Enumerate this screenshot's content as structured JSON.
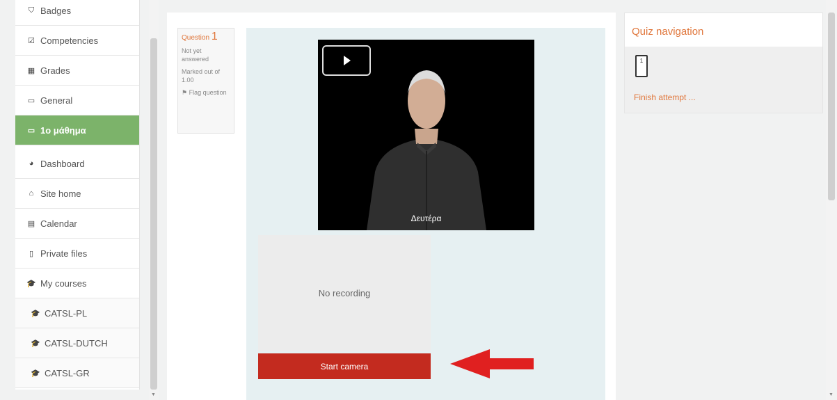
{
  "sidebar": {
    "items": [
      {
        "label": "Badges",
        "icon": "shield-icon",
        "glyph": "⛉"
      },
      {
        "label": "Competencies",
        "icon": "checkbox-icon",
        "glyph": "☑"
      },
      {
        "label": "Grades",
        "icon": "table-icon",
        "glyph": "▦"
      },
      {
        "label": "General",
        "icon": "folder-icon",
        "glyph": "▭"
      },
      {
        "label": "1ο μάθημα",
        "icon": "folder-icon",
        "glyph": "▭"
      },
      {
        "label": "Dashboard",
        "icon": "dashboard-icon",
        "glyph": "◕"
      },
      {
        "label": "Site home",
        "icon": "home-icon",
        "glyph": "⌂"
      },
      {
        "label": "Calendar",
        "icon": "calendar-icon",
        "glyph": "▤"
      },
      {
        "label": "Private files",
        "icon": "file-icon",
        "glyph": "▯"
      },
      {
        "label": "My courses",
        "icon": "graduation-cap-icon",
        "glyph": "🎓"
      },
      {
        "label": "CATSL-PL",
        "icon": "graduation-cap-icon",
        "glyph": "🎓"
      },
      {
        "label": "CATSL-DUTCH",
        "icon": "graduation-cap-icon",
        "glyph": "🎓"
      },
      {
        "label": "CATSL-GR",
        "icon": "graduation-cap-icon",
        "glyph": "🎓"
      }
    ]
  },
  "question": {
    "label": "Question",
    "number": "1",
    "status": "Not yet answered",
    "marks": "Marked out of 1.00",
    "flag": "Flag question"
  },
  "video": {
    "caption": "Δευτέρα"
  },
  "recording": {
    "status": "No recording",
    "button": "Start camera"
  },
  "quiz_nav": {
    "title": "Quiz navigation",
    "question_button": "1",
    "finish": "Finish attempt ..."
  },
  "colors": {
    "accent": "#e0763b",
    "active_nav": "#7cb36a",
    "button": "#c32b1f",
    "arrow": "#e02020"
  }
}
